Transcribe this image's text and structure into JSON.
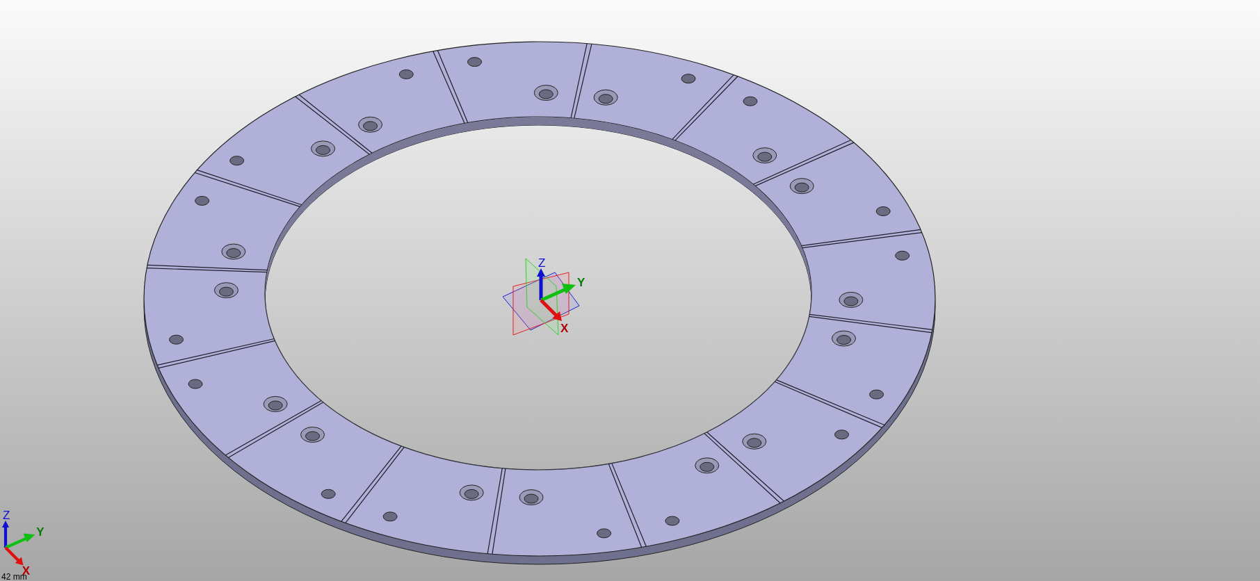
{
  "center_triad": {
    "z_label": "Z",
    "y_label": "Y",
    "x_label": "X"
  },
  "corner_triad": {
    "z_label": "Z",
    "y_label": "Y",
    "x_label": "X"
  },
  "scale_label": "42 mm"
}
